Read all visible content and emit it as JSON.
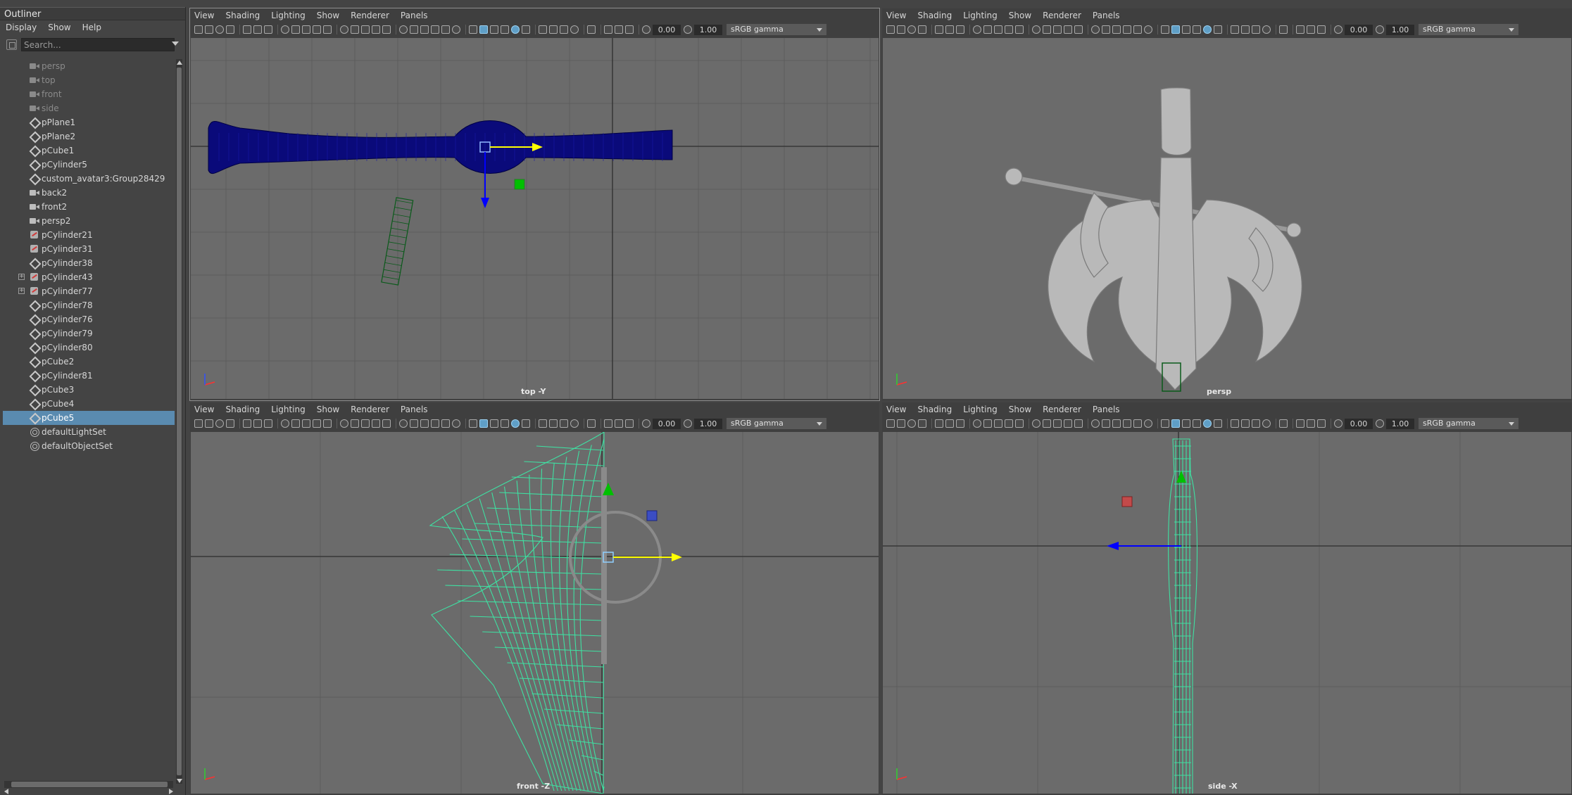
{
  "outliner": {
    "title": "Outliner",
    "menu": [
      "Display",
      "Show",
      "Help"
    ],
    "search_placeholder": "Search...",
    "items": [
      {
        "label": "persp",
        "icon": "camera-icon",
        "dim": true
      },
      {
        "label": "top",
        "icon": "camera-icon",
        "dim": true
      },
      {
        "label": "front",
        "icon": "camera-icon",
        "dim": true
      },
      {
        "label": "side",
        "icon": "camera-icon",
        "dim": true
      },
      {
        "label": "pPlane1",
        "icon": "transform-icon"
      },
      {
        "label": "pPlane2",
        "icon": "transform-icon"
      },
      {
        "label": "pCube1",
        "icon": "transform-icon"
      },
      {
        "label": "pCylinder5",
        "icon": "transform-icon"
      },
      {
        "label": "custom_avatar3:Group28429",
        "icon": "transform-icon"
      },
      {
        "label": "back2",
        "icon": "camera-icon"
      },
      {
        "label": "front2",
        "icon": "camera-icon"
      },
      {
        "label": "persp2",
        "icon": "camera-icon"
      },
      {
        "label": "pCylinder21",
        "icon": "cylinder-icon"
      },
      {
        "label": "pCylinder31",
        "icon": "cylinder-icon"
      },
      {
        "label": "pCylinder38",
        "icon": "transform-icon"
      },
      {
        "label": "pCylinder43",
        "icon": "cylinder-icon",
        "expandable": true
      },
      {
        "label": "pCylinder77",
        "icon": "cylinder-icon",
        "expandable": true
      },
      {
        "label": "pCylinder78",
        "icon": "transform-icon"
      },
      {
        "label": "pCylinder76",
        "icon": "transform-icon"
      },
      {
        "label": "pCylinder79",
        "icon": "transform-icon"
      },
      {
        "label": "pCylinder80",
        "icon": "transform-icon"
      },
      {
        "label": "pCube2",
        "icon": "transform-icon"
      },
      {
        "label": "pCylinder81",
        "icon": "transform-icon"
      },
      {
        "label": "pCube3",
        "icon": "transform-icon"
      },
      {
        "label": "pCube4",
        "icon": "transform-icon"
      },
      {
        "label": "pCube5",
        "icon": "transform-icon",
        "selected": true
      },
      {
        "label": "defaultLightSet",
        "icon": "set-icon"
      },
      {
        "label": "defaultObjectSet",
        "icon": "set-icon"
      }
    ]
  },
  "panel_menu": [
    "View",
    "Shading",
    "Lighting",
    "Show",
    "Renderer",
    "Panels"
  ],
  "toolbar": {
    "field_a": "0.00",
    "field_b": "1.00",
    "color_space": "sRGB gamma",
    "expand_glyph": "+"
  },
  "panels": {
    "top": {
      "camera": "top -Y"
    },
    "persp": {
      "camera": "persp"
    },
    "front": {
      "camera": "front -Z"
    },
    "side": {
      "camera": "side -X"
    }
  },
  "colors": {
    "viewport_bg": "#6b6b6b",
    "grid": "#5c5c5c",
    "grid_axis": "#2e2e2e",
    "wire_blue": "#0a0a7a",
    "wire_green": "#3fe0a2",
    "selection_blue": "#5a8bb0",
    "manip_yellow": "#ffff00",
    "manip_blue": "#0000ff",
    "manip_green": "#00c000"
  }
}
